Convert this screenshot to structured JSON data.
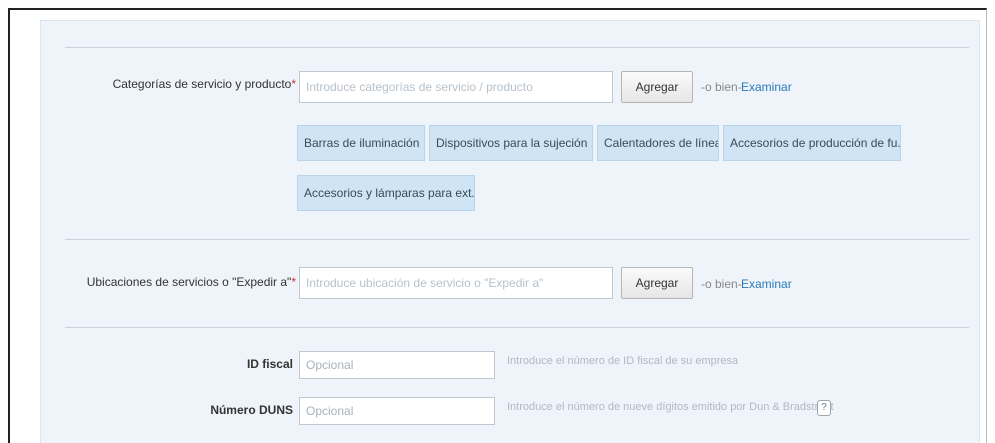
{
  "categories": {
    "label": "Categorías de servicio y producto",
    "required_mark": "*",
    "placeholder": "Introduce categorías de servicio / producto",
    "add_button": "Agregar",
    "or_text": "-o bien-",
    "browse_link": "Examinar",
    "chips": [
      "Barras de iluminación",
      "Dispositivos para la sujeción ...",
      "Calentadores de línea",
      "Accesorios de producción de fu...",
      "Accesorios y lámparas para ext..."
    ],
    "chip_remove": "×"
  },
  "locations": {
    "label": "Ubicaciones de servicios o \"Expedir a\"",
    "required_mark": "*",
    "placeholder": "Introduce ubicación de servicio o \"Expedir a\"",
    "add_button": "Agregar",
    "or_text": "-o bien-",
    "browse_link": "Examinar"
  },
  "tax_id": {
    "label": "ID fiscal",
    "value": "Opcional",
    "hint": "Introduce el número de ID fiscal de su empresa"
  },
  "duns": {
    "label": "Número DUNS",
    "value": "Opcional",
    "hint": "Introduce el número de nueve dígitos emitido por Dun & Bradstreet",
    "help_icon": "?"
  }
}
